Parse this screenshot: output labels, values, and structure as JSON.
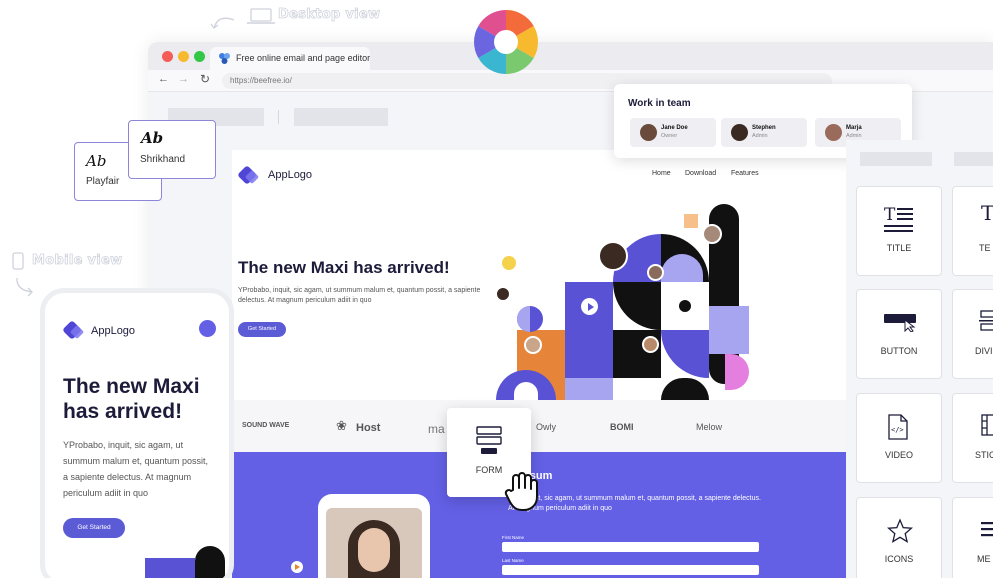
{
  "annotations": {
    "desktop_view": "Desktop view",
    "mobile_view": "Mobile view"
  },
  "browser": {
    "tab_title": "Free online email and page editor",
    "url": "https://beefree.io/",
    "traffic_lights": [
      "#f45c58",
      "#f7b92e",
      "#33c748"
    ]
  },
  "team": {
    "title": "Work in team",
    "members": [
      {
        "name": "Jane Doe",
        "role": "Owner"
      },
      {
        "name": "Stephen",
        "role": "Admin"
      },
      {
        "name": "Marja",
        "role": "Admin"
      }
    ]
  },
  "fonts": [
    {
      "sample": "Ab",
      "name": "Playfair"
    },
    {
      "sample": "Ab",
      "name": "Shrikhand"
    }
  ],
  "page": {
    "logo": "AppLogo",
    "nav": [
      "Home",
      "Download",
      "Features"
    ],
    "hero_title": "The new Maxi has arrived!",
    "hero_text": "YProbabo, inquit, sic agam, ut summum malum et, quantum possit, a sapiente delectus. At magnum periculum adiit in quo",
    "hero_button": "Get Started",
    "brands": [
      "SOUND WAVE",
      "Host",
      "ma",
      "Owly",
      "BOMI",
      "Melow"
    ],
    "section_title": "ipsum",
    "section_text": "abo, inquit, sic agam, ut summum malum et, quantum possit, a sapiente delectus. At magnum periculum adiit in quo",
    "form_labels": [
      "First Name",
      "Last Name"
    ]
  },
  "mobile": {
    "logo": "AppLogo",
    "hero_title": "The new Maxi has arrived!",
    "hero_text": "YProbabo, inquit, sic agam, ut summum malum et, quantum possit, a sapiente delectus. At magnum periculum adiit in quo",
    "hero_button": "Get Started"
  },
  "panel": {
    "blocks": [
      "TITLE",
      "TE",
      "BUTTON",
      "DIVI",
      "VIDEO",
      "STIC",
      "ICONS",
      "ME"
    ]
  },
  "drag": {
    "label": "FORM"
  },
  "colors": {
    "accent": "#5b5bd6",
    "purple_section": "#6360e6",
    "dark": "#1c1c3a"
  }
}
